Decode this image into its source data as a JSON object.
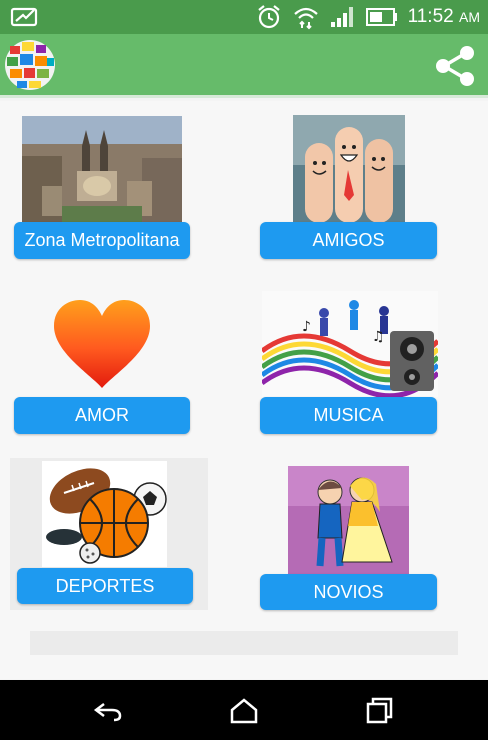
{
  "status_bar": {
    "time": "11:52",
    "ampm": "AM",
    "icons": [
      "whatsapp-like-icon",
      "alarm-icon",
      "wifi-icon",
      "signal-icon",
      "battery-icon"
    ]
  },
  "app_bar": {
    "logo_icon": "colorful-globe-logo",
    "share_icon": "share-icon"
  },
  "categories": [
    {
      "label": "Zona Metropolitana",
      "image": "city-skyline-photo"
    },
    {
      "label": "AMIGOS",
      "image": "finger-faces-photo"
    },
    {
      "label": "AMOR",
      "image": "red-heart"
    },
    {
      "label": "MUSICA",
      "image": "music-speaker-dancers"
    },
    {
      "label": "DEPORTES",
      "image": "sports-balls"
    },
    {
      "label": "NOVIOS",
      "image": "bride-groom-cartoon"
    }
  ],
  "colors": {
    "status_bar": "#4a9b4c",
    "app_bar": "#66bb6a",
    "button": "#1e9af0"
  },
  "nav_bar": {
    "icons": [
      "back-icon",
      "home-icon",
      "recents-icon"
    ]
  }
}
